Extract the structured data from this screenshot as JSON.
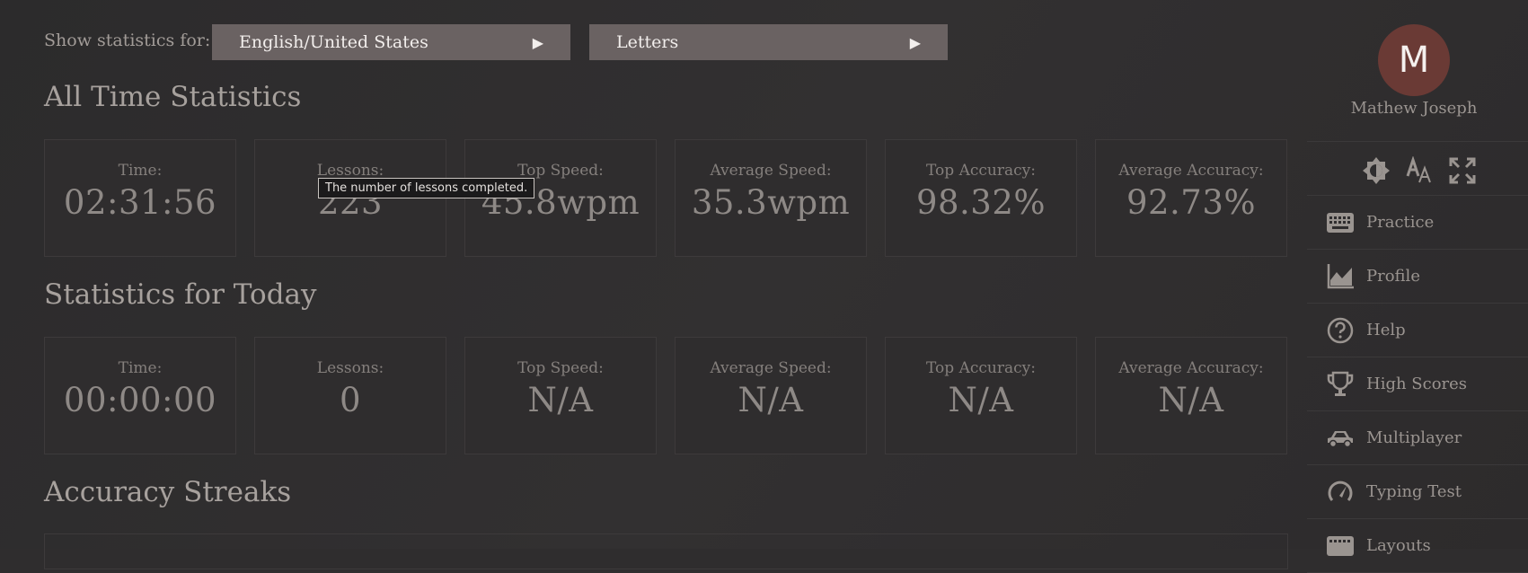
{
  "filters": {
    "label": "Show statistics for:",
    "language": "English/United States",
    "mode": "Letters"
  },
  "all_time": {
    "title": "All Time Statistics",
    "stats": [
      {
        "label": "Time:",
        "value": "02:31:56"
      },
      {
        "label": "Lessons:",
        "value": "223"
      },
      {
        "label": "Top Speed:",
        "value": "45.8wpm"
      },
      {
        "label": "Average Speed:",
        "value": "35.3wpm"
      },
      {
        "label": "Top Accuracy:",
        "value": "98.32%"
      },
      {
        "label": "Average Accuracy:",
        "value": "92.73%"
      }
    ]
  },
  "today": {
    "title": "Statistics for Today",
    "stats": [
      {
        "label": "Time:",
        "value": "00:00:00"
      },
      {
        "label": "Lessons:",
        "value": "0"
      },
      {
        "label": "Top Speed:",
        "value": "N/A"
      },
      {
        "label": "Average Speed:",
        "value": "N/A"
      },
      {
        "label": "Top Accuracy:",
        "value": "N/A"
      },
      {
        "label": "Average Accuracy:",
        "value": "N/A"
      }
    ]
  },
  "streaks": {
    "title": "Accuracy Streaks"
  },
  "tooltip": "The number of lessons completed.",
  "user": {
    "initial": "M",
    "name": "Mathew Joseph"
  },
  "nav": {
    "items": [
      {
        "label": "Practice",
        "icon": "keyboard-icon"
      },
      {
        "label": "Profile",
        "icon": "chart-icon"
      },
      {
        "label": "Help",
        "icon": "help-icon"
      },
      {
        "label": "High Scores",
        "icon": "trophy-icon"
      },
      {
        "label": "Multiplayer",
        "icon": "car-icon"
      },
      {
        "label": "Typing Test",
        "icon": "speedometer-icon"
      },
      {
        "label": "Layouts",
        "icon": "keyboard-icon"
      }
    ]
  },
  "colors": {
    "background": "#2f2d2e",
    "select_bg": "#6a6262",
    "avatar_bg": "#6a3a35",
    "text": "#8f8a87"
  }
}
